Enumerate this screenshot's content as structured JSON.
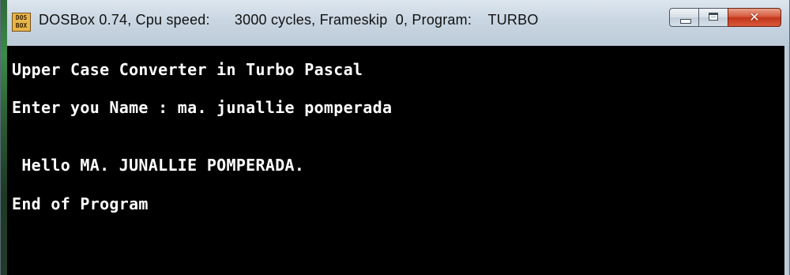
{
  "window": {
    "icon_text": "DOS\nBOX",
    "title": "DOSBox 0.74, Cpu speed:      3000 cycles, Frameskip  0, Program:    TURBO",
    "controls": {
      "minimize_icon": "minimize-icon",
      "maximize_icon": "maximize-icon",
      "close_icon": "close-icon",
      "close_glyph": "✕"
    }
  },
  "console": {
    "lines": [
      "Upper Case Converter in Turbo Pascal",
      "Enter you Name : ma. junallie pomperada",
      " Hello MA. JUNALLIE POMPERADA.",
      "End of Program"
    ]
  },
  "colors": {
    "screen_bg": "#000000",
    "text": "#ffffff",
    "close_button": "#c3371c"
  }
}
